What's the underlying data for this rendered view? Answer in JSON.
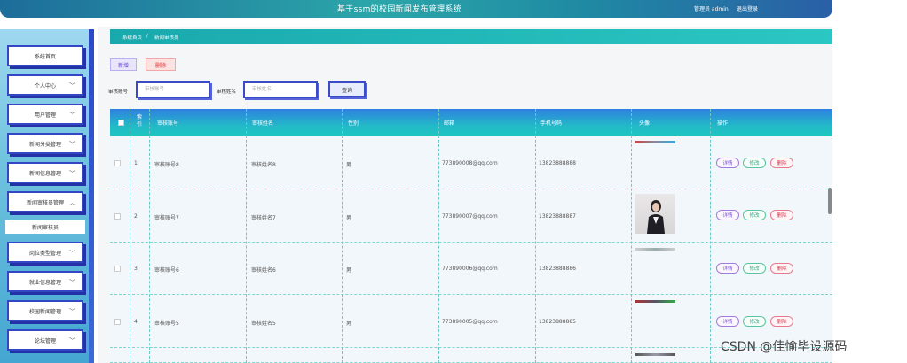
{
  "header": {
    "title": "基于ssm的校园新闻发布管理系统",
    "user": "管理员 admin",
    "logout": "退出登录"
  },
  "sidebar": {
    "items": [
      {
        "label": "系统首页",
        "has_chevron": false
      },
      {
        "label": "个人中心",
        "has_chevron": true
      },
      {
        "label": "用户管理",
        "has_chevron": true
      },
      {
        "label": "新闻分类管理",
        "has_chevron": true
      },
      {
        "label": "新闻信息管理",
        "has_chevron": true
      },
      {
        "label": "新闻审核员管理",
        "has_chevron": true,
        "expanded": true
      },
      {
        "label": "岗位类型管理",
        "has_chevron": true
      },
      {
        "label": "就业信息管理",
        "has_chevron": true
      },
      {
        "label": "校园新闻管理",
        "has_chevron": true
      },
      {
        "label": "论坛管理",
        "has_chevron": true
      }
    ],
    "subitem": "新闻审核员"
  },
  "breadcrumb": {
    "home": "系统首页",
    "separator": "/",
    "current": "新闻审核员"
  },
  "toolbar": {
    "add_label": "新增",
    "delete_label": "删除"
  },
  "search": {
    "account_label": "审核账号",
    "account_placeholder": "审核账号",
    "name_label": "审核姓名",
    "name_placeholder": "审核姓名",
    "button_label": "查询"
  },
  "table": {
    "headers": [
      "索引",
      "审核账号",
      "审核姓名",
      "性别",
      "邮箱",
      "手机号码",
      "头像",
      "操作"
    ],
    "rows": [
      {
        "index": "1",
        "account": "审核账号8",
        "name": "审核姓名8",
        "gender": "男",
        "email": "773890008@qq.com",
        "phone": "13823888888"
      },
      {
        "index": "2",
        "account": "审核账号7",
        "name": "审核姓名7",
        "gender": "男",
        "email": "773890007@qq.com",
        "phone": "13823888887"
      },
      {
        "index": "3",
        "account": "审核账号6",
        "name": "审核姓名6",
        "gender": "男",
        "email": "773890006@qq.com",
        "phone": "13823888886"
      },
      {
        "index": "4",
        "account": "审核账号5",
        "name": "审核姓名5",
        "gender": "男",
        "email": "773890005@qq.com",
        "phone": "13823888885"
      }
    ],
    "actions": {
      "detail": "详情",
      "edit": "修改",
      "delete": "删除"
    }
  },
  "watermark": "CSDN @佳愉毕设源码",
  "colors": {
    "accent": "#1ec5c0",
    "sidebar_border": "#3347c4",
    "header": "#2ba6a9"
  }
}
